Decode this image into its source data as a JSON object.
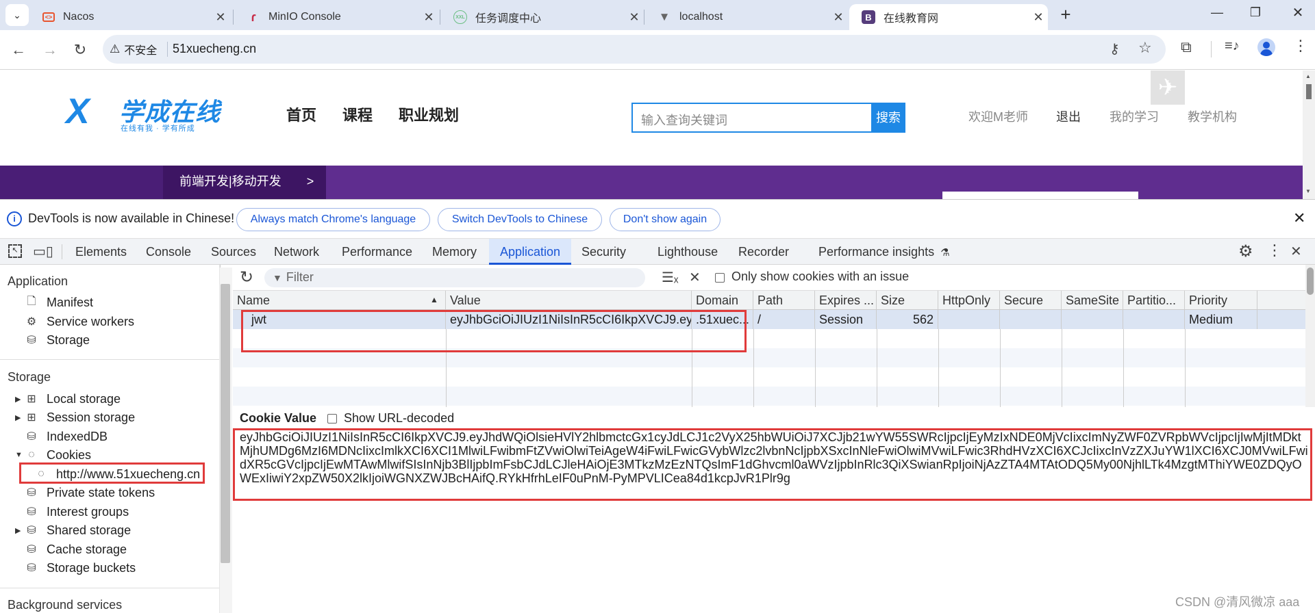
{
  "browser": {
    "tabs": [
      {
        "title": "Nacos",
        "favicon": "nacos-icon"
      },
      {
        "title": "MinIO Console",
        "favicon": "minio-icon"
      },
      {
        "title": "任务调度中心",
        "favicon": "xxl-job-icon"
      },
      {
        "title": "localhost",
        "favicon": "vite-icon"
      },
      {
        "title": "在线教育网",
        "favicon": "bootstrap-icon",
        "active": true
      }
    ],
    "security_label": "不安全",
    "url": "51xuecheng.cn"
  },
  "site": {
    "logo_text": "学成在线",
    "logo_tagline": "在线有我 · 学有所成",
    "nav": [
      "首页",
      "课程",
      "职业规划"
    ],
    "search_placeholder": "输入查询关键词",
    "search_button": "搜索",
    "welcome": "欢迎M老师",
    "logout": "退出",
    "my_learning": "我的学习",
    "teaching_org": "教学机构",
    "banner_menu": "前端开发|移动开发",
    "banner_arrow": ">"
  },
  "devtools": {
    "infobar": {
      "message": "DevTools is now available in Chinese!",
      "btn_match": "Always match Chrome's language",
      "btn_switch": "Switch DevTools to Chinese",
      "btn_dont": "Don't show again"
    },
    "tabs": [
      "Elements",
      "Console",
      "Sources",
      "Network",
      "Performance",
      "Memory",
      "Application",
      "Security",
      "Lighthouse",
      "Recorder",
      "Performance insights"
    ],
    "active_tab": "Application",
    "sidebar": {
      "application_header": "Application",
      "application_items": [
        "Manifest",
        "Service workers",
        "Storage"
      ],
      "storage_header": "Storage",
      "storage_items": [
        "Local storage",
        "Session storage",
        "IndexedDB",
        "Cookies",
        "http://www.51xuecheng.cn",
        "Private state tokens",
        "Interest groups",
        "Shared storage",
        "Cache storage",
        "Storage buckets"
      ],
      "background_header": "Background services"
    },
    "toolbar": {
      "filter_placeholder": "Filter",
      "only_issue_label": "Only show cookies with an issue"
    },
    "columns": [
      "Name",
      "Value",
      "Domain",
      "Path",
      "Expires ...",
      "Size",
      "HttpOnly",
      "Secure",
      "SameSite",
      "Partitio...",
      "Priority"
    ],
    "rows": [
      {
        "name": "jwt",
        "value": "eyJhbGciOiJIUzI1NiIsInR5cCI6IkpXVCJ9.eyJhdWQiOl...",
        "domain": ".51xuec...",
        "path": "/",
        "expires": "Session",
        "size": "562",
        "httponly": "",
        "secure": "",
        "samesite": "",
        "partition": "",
        "priority": "Medium"
      }
    ],
    "cookie_value_label": "Cookie Value",
    "show_decoded_label": "Show URL-decoded",
    "cookie_value": "eyJhbGciOiJIUzI1NiIsInR5cCI6IkpXVCJ9.eyJhdWQiOlsieHVlY2hlbmctcGx1cyJdLCJ1c2VyX25hbWUiOiJ7XCJjb21wYW55SWRcIjpcIjEyMzIxNDE0MjVcIixcImNyZWF0ZVRpbWVcIjpcIjIwMjItMDktMjhUMDg6MzI6MDNcIixcImlkXCI6XCI1MlwiLFwibmFtZVwiOlwiTeiAgeW4iFwiLFwicGVybWlzc2lvbnNcIjpbXSxcInNleFwiOlwiMVwiLFwic3RhdHVzXCI6XCJcIixcInVzZXJuYW1lXCI6XCJ0MVwiLFwidXR5cGVcIjpcIjEwMTAwMlwifSIsInNjb3BlIjpbImFsbCJdLCJleHAiOjE3MTkzMzEzNTQsImF1dGhvcml0aWVzIjpbInRlc3QiXSwianRpIjoiNjAzZTA4MTAtODQ5My00NjhlLTk4MzgtMThiYWE0ZDQyOWExIiwiY2xpZW50X2lkIjoiWGNXZWJBcHAifQ.RYkHfrhLeIF0uPnM-PyMPVLICea84d1kcpJvR1Plr9g"
  },
  "watermark": "CSDN @清风微凉 aaa"
}
